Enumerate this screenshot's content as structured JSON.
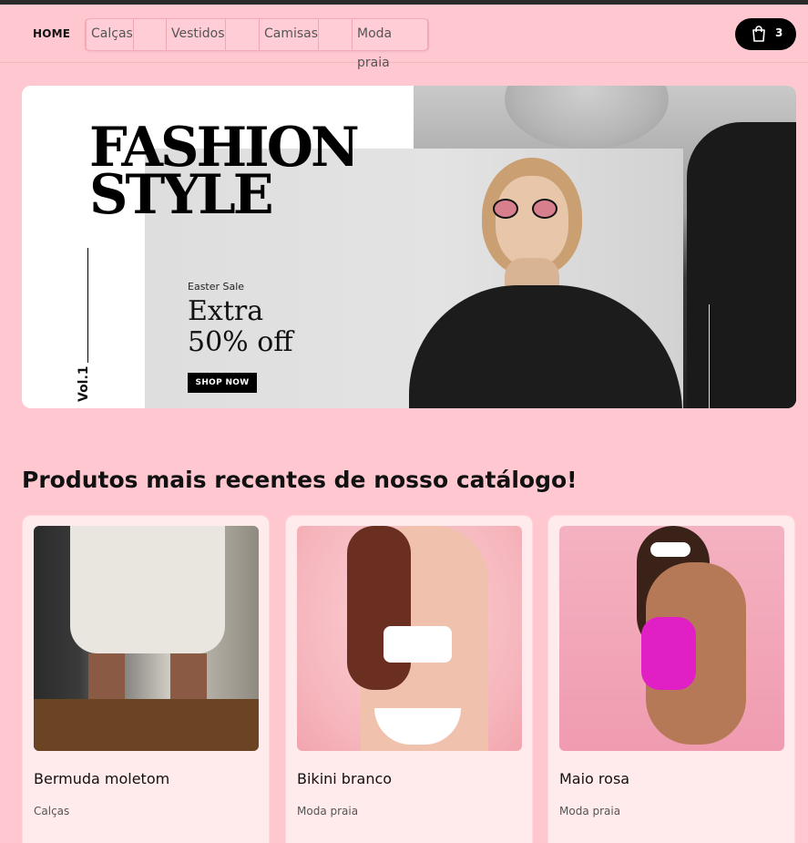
{
  "nav": {
    "home": "HOME",
    "categories": [
      "Calças",
      "Vestidos",
      "Camisas",
      "Moda praia"
    ],
    "cart_count": "3"
  },
  "banner": {
    "title_line1": "FASHION",
    "title_line2": "STYLE",
    "volume": "Vol.1",
    "sale_label": "Easter Sale",
    "sale_line1": "Extra",
    "sale_line2": "50% off",
    "cta": "SHOP NOW"
  },
  "section": {
    "title": "Produtos mais recentes de nosso catálogo!"
  },
  "products": [
    {
      "name": "Bermuda moletom",
      "category": "Calças"
    },
    {
      "name": "Bikini branco",
      "category": "Moda praia"
    },
    {
      "name": "Maio rosa",
      "category": "Moda praia"
    }
  ],
  "icons": {
    "cart": "shopping-bag-icon"
  }
}
